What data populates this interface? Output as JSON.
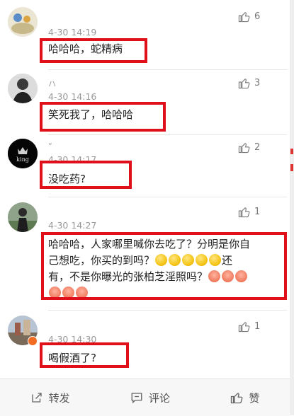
{
  "comments": [
    {
      "username": "",
      "time": "4-30 14:19",
      "likes": "6",
      "text": "哈哈哈，蛇精病"
    },
    {
      "username": "ハ",
      "time": "4-30 14:16",
      "likes": "3",
      "text": "笑死我了，哈哈哈"
    },
    {
      "username": "“",
      "time": "4-30 14:17",
      "likes": "2",
      "text": "没吃药?",
      "avatar_label": "king"
    },
    {
      "username": "",
      "time": "4-30 14:27",
      "likes": "1",
      "text_line1": "哈哈哈，人家哪里喊你去吃了？分明是你自",
      "text_line2": "己想吃，你买的到吗？",
      "text_line3_a": "还",
      "text_line3_b": "有，不是你曝光的张柏芝淫照吗？"
    },
    {
      "username": "",
      "time": "4-30 14:30",
      "likes": "1",
      "text": "喝假酒了?"
    }
  ],
  "actions": {
    "repost": "转发",
    "comment": "评论",
    "like": "赞"
  },
  "icons": [
    "thumb-up-icon",
    "share-icon",
    "comment-icon",
    "verified-badge-icon",
    "coin-emoji",
    "pig-emoji"
  ],
  "colors": {
    "highlight": "#e0101b",
    "meta": "#999999"
  }
}
